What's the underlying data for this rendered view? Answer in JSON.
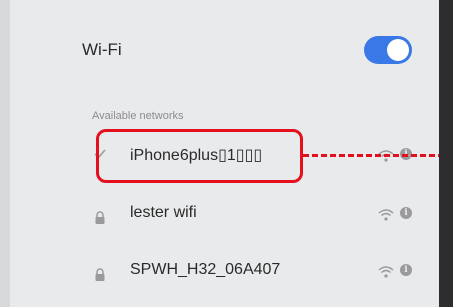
{
  "wifi": {
    "title": "Wi-Fi",
    "enabled": true
  },
  "networks_section": {
    "label": "Available networks"
  },
  "networks": [
    {
      "name": "iPhone6plus▯1▯▯▯",
      "status_icon": "check-icon",
      "secured": false,
      "connected": true
    },
    {
      "name": "lester wifi",
      "status_icon": "lock-icon",
      "secured": true,
      "connected": false
    },
    {
      "name": "SPWH_H32_06A407",
      "status_icon": "lock-icon",
      "secured": true,
      "connected": false
    }
  ],
  "colors": {
    "accent": "#3b78e7",
    "annotation": "#e3101e",
    "background": "#e9eaec"
  },
  "info_glyph": "i"
}
